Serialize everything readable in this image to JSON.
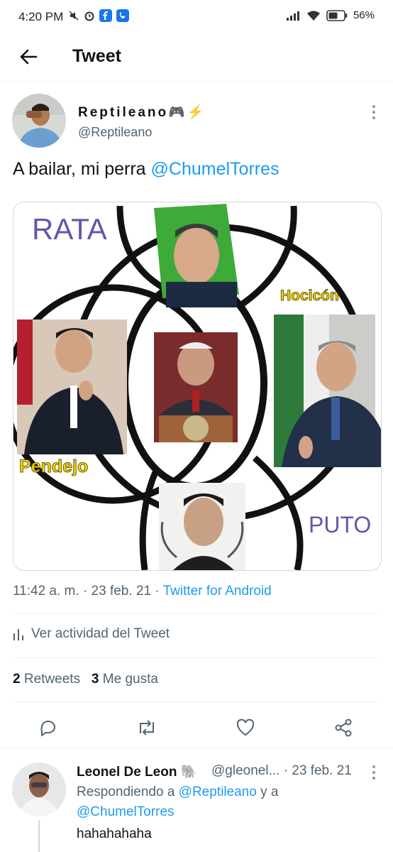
{
  "status_bar": {
    "time": "4:20 PM",
    "battery": "56%"
  },
  "header": {
    "title": "Tweet"
  },
  "tweet": {
    "author_name": "Reptileano🎮⚡",
    "author_handle": "@Reptileano",
    "text_main": "A bailar, mi perra ",
    "text_mention": "@ChumelTorres",
    "time": "11:42 a. m.",
    "date": "23 feb. 21",
    "source": "Twitter for Android",
    "activity_label": "Ver actividad del Tweet",
    "retweets_count": "2",
    "retweets_label": "Retweets",
    "likes_count": "3",
    "likes_label": "Me gusta"
  },
  "meme": {
    "label_rata": "RATA",
    "label_hocicon": "Hocicón",
    "label_pendejo": "Pendejo",
    "label_puto": "PUTO"
  },
  "reply": {
    "author_name": "Leonel De Leon 🐘",
    "author_handle": "@gleonel... · 23 feb. 21",
    "replying_prefix": "Respondiendo a ",
    "replying_mention1": "@Reptileano",
    "replying_and": " y a",
    "replying_mention2": "@ChumelTorres",
    "text": "hahahahaha"
  },
  "colors": {
    "link": "#1d9bf0",
    "secondary": "#536471",
    "meme_purple": "#6655aa",
    "meme_yellow": "#f5d90a"
  }
}
